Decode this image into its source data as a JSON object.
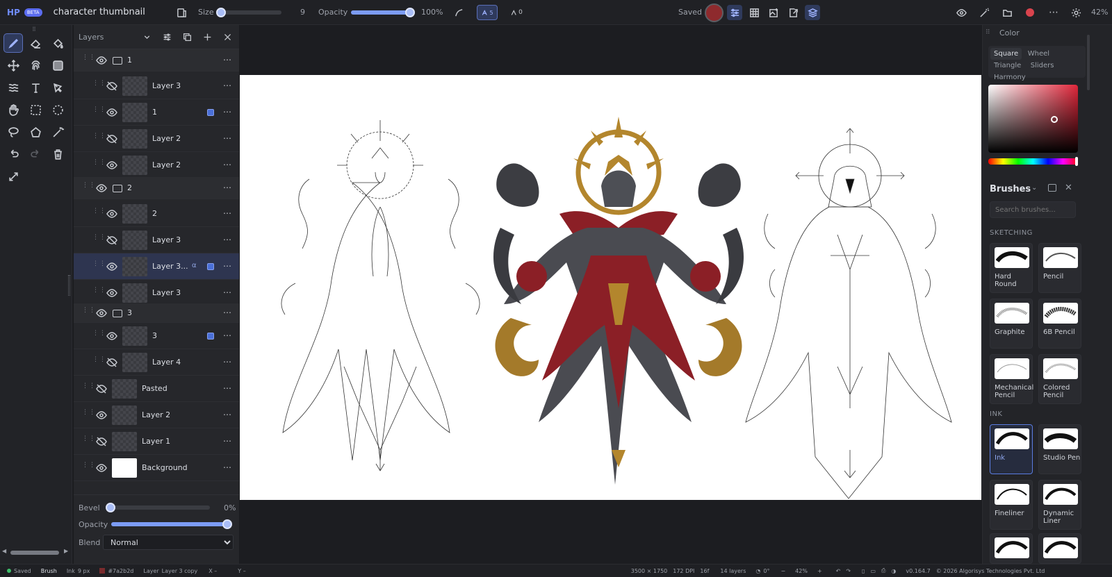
{
  "app": {
    "logo": "HP",
    "beta": "BETA",
    "title": "character thumbnail"
  },
  "toolbar": {
    "size_label": "Size",
    "size_value": "9",
    "size_fraction": 0.0,
    "opacity_label": "Opacity",
    "opacity_value": "100%",
    "opacity_fraction": 1.0,
    "stabilizer_value": "5",
    "pressure_value": "0",
    "saved_label": "Saved",
    "zoom_label": "42%",
    "primary_color": "#8e2a2d"
  },
  "layers_panel": {
    "title": "Layers",
    "rows": [
      {
        "name": "1",
        "type": "group",
        "visible": true
      },
      {
        "name": "Layer 3",
        "type": "layer",
        "visible": false
      },
      {
        "name": "1",
        "type": "layer",
        "visible": true,
        "badge": true
      },
      {
        "name": "Layer 2",
        "type": "layer",
        "visible": false
      },
      {
        "name": "Layer 2",
        "type": "layer",
        "visible": true
      },
      {
        "name": "2",
        "type": "group",
        "visible": true
      },
      {
        "name": "2",
        "type": "layer",
        "visible": true
      },
      {
        "name": "Layer 3",
        "type": "layer",
        "visible": false
      },
      {
        "name": "Layer 3...",
        "type": "layer",
        "visible": true,
        "selected": true,
        "alpha": "α",
        "badge": true
      },
      {
        "name": "Layer 3",
        "type": "layer",
        "visible": true
      },
      {
        "name": "3",
        "type": "group",
        "visible": true
      },
      {
        "name": "3",
        "type": "layer",
        "visible": true,
        "badge": true
      },
      {
        "name": "Layer 4",
        "type": "layer",
        "visible": false
      },
      {
        "name": "Pasted",
        "type": "layer",
        "visible": false
      },
      {
        "name": "Layer 2",
        "type": "layer",
        "visible": true
      },
      {
        "name": "Layer 1",
        "type": "layer",
        "visible": false
      },
      {
        "name": "Background",
        "type": "layer",
        "visible": true,
        "white": true
      }
    ],
    "bevel_label": "Bevel",
    "bevel_value": "0%",
    "bevel_fraction": 0.0,
    "opacity_label": "Opacity",
    "opacity_fraction": 1.0,
    "blend_label": "Blend",
    "blend_value": "Normal"
  },
  "color_panel": {
    "title": "Color",
    "tabs": [
      "Square",
      "Wheel",
      "Triangle",
      "Sliders",
      "Harmony"
    ],
    "active_tab": "Square"
  },
  "brushes_panel": {
    "title": "Brushes",
    "search_placeholder": "Search brushes...",
    "sections": [
      {
        "name": "SKETCHING",
        "brushes": [
          "Hard Round",
          "Pencil",
          "Graphite",
          "6B Pencil",
          "Mechanical Pencil",
          "Colored Pencil"
        ]
      },
      {
        "name": "INK",
        "brushes": [
          "Ink",
          "Studio Pen",
          "Fineliner",
          "Dynamic Liner"
        ]
      }
    ],
    "active_brush": "Ink"
  },
  "status_bar": {
    "saved": "Saved",
    "mode": "Brush",
    "brush": "Ink",
    "brush_size": "9 px",
    "color_hex": "#7a2b2d",
    "layer_label": "Layer",
    "layer_name": "Layer 3 copy",
    "x_label": "X –",
    "y_label": "Y –",
    "dimensions": "3500 × 1750",
    "dpi": "172 DPI",
    "bit_depth": "16f",
    "layer_count": "14 layers",
    "rotation": "0°",
    "zoom": "42%",
    "version": "v0.164.7",
    "copyright": "© 2026 Algorisys Technologies Pvt. Ltd"
  }
}
